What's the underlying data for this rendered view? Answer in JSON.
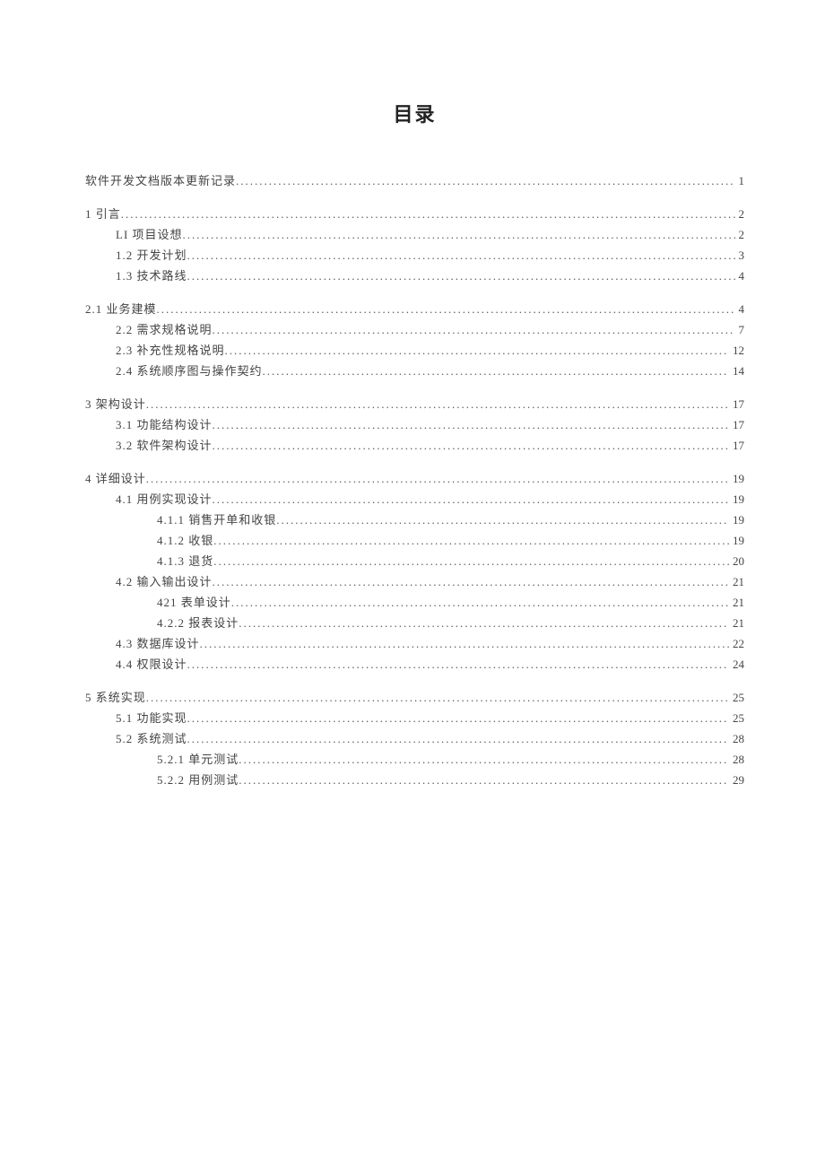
{
  "title": "目录",
  "toc": [
    {
      "group": [
        {
          "level": 0,
          "label": "软件开发文档版本更新记录 ",
          "page": "1"
        }
      ]
    },
    {
      "group": [
        {
          "level": 0,
          "label": "1 引言",
          "page": "2"
        },
        {
          "level": 1,
          "label": "LI 项目设想",
          "page": "2"
        },
        {
          "level": 1,
          "label": "1.2  开发计划",
          "page": "3"
        },
        {
          "level": 1,
          "label": "1.3  技术路线",
          "page": "4"
        }
      ]
    },
    {
      "group": [
        {
          "level": 0,
          "label": "2.1  业务建模 ",
          "page": "4"
        },
        {
          "level": 1,
          "label": "2.2  需求规格说明 ",
          "page": "7"
        },
        {
          "level": 1,
          "label": "2.3  补充性规格说明",
          "page": " 12"
        },
        {
          "level": 1,
          "label": "2.4  系统顺序图与操作契约 ",
          "page": " 14"
        }
      ]
    },
    {
      "group": [
        {
          "level": 0,
          "label": "3 架构设计",
          "page": " 17"
        },
        {
          "level": 1,
          "label": "3.1  功能结构设计",
          "page": " 17"
        },
        {
          "level": 1,
          "label": "3.2  软件架构设计 ",
          "page": " 17"
        }
      ]
    },
    {
      "group": [
        {
          "level": 0,
          "label": "4 详细设计",
          "page": " 19"
        },
        {
          "level": 1,
          "label": "4.1  用例实现设计",
          "page": " 19"
        },
        {
          "level": 2,
          "label": "4.1.1  销售开单和收银",
          "page": " 19"
        },
        {
          "level": 2,
          "label": "4.1.2  收银 ",
          "page": " 19"
        },
        {
          "level": 2,
          "label": "4.1.3  退货",
          "page": " 20"
        },
        {
          "level": 1,
          "label": "4.2  输入输出设计 ",
          "page": " 21"
        },
        {
          "level": 2,
          "label": "421 表单设计 ",
          "page": " 21"
        },
        {
          "level": 2,
          "label": "4.2.2 报表设计 ",
          "page": " 21"
        },
        {
          "level": 1,
          "label": "4.3  数据库设计 ",
          "page": " 22"
        },
        {
          "level": 1,
          "label": "4.4  权限设计 ",
          "page": " 24"
        }
      ]
    },
    {
      "group": [
        {
          "level": 0,
          "label": "5 系统实现",
          "page": " 25"
        },
        {
          "level": 1,
          "label": "5.1  功能实现",
          "page": " 25"
        },
        {
          "level": 1,
          "label": "5.2  系统测试 ",
          "page": " 28"
        },
        {
          "level": 2,
          "label": "5.2.1  单元测试",
          "page": " 28"
        },
        {
          "level": 2,
          "label": "5.2.2  用例测试",
          "page": " 29"
        }
      ]
    }
  ]
}
